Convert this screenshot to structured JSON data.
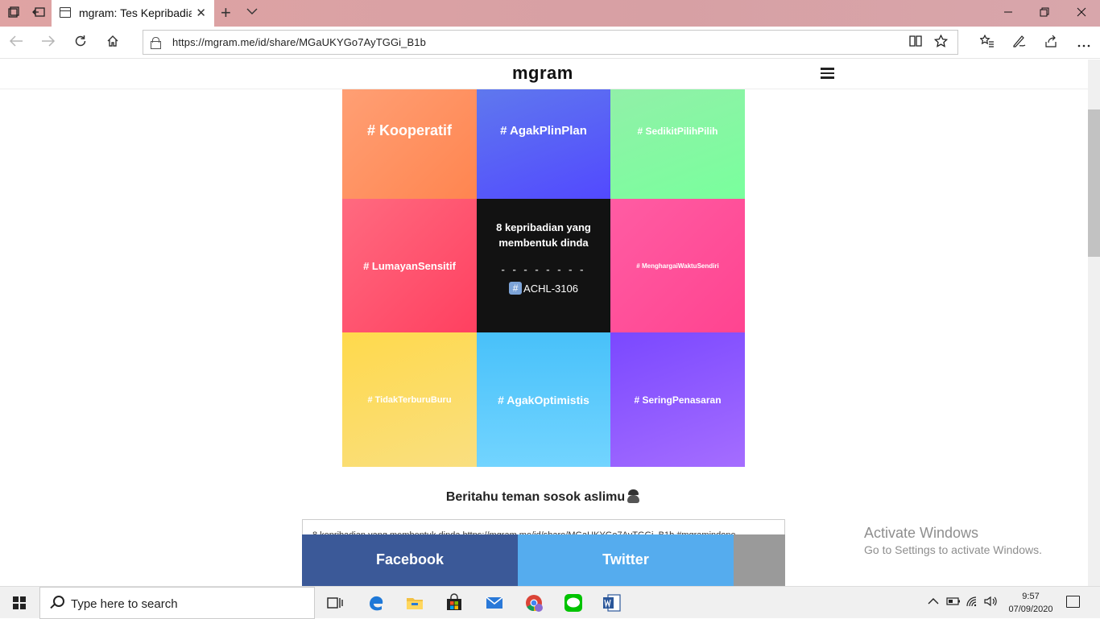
{
  "browser": {
    "tab_title": "mgram: Tes Kepribadiar",
    "tab_close": "✕",
    "new_tab": "+",
    "tab_menu": "⌵",
    "url": "https://mgram.me/id/share/MGaUKYGo7AyTGGi_B1b",
    "window_controls": {
      "minimize": "—",
      "restore": "❐",
      "close": "✕"
    }
  },
  "site": {
    "logo": "mgram"
  },
  "grid": {
    "cells": [
      {
        "tag": "# Kooperatif",
        "gradient": [
          "#ff9e6e",
          "#ff7e4e"
        ]
      },
      {
        "tag": "# AgakPlinPlan",
        "gradient": [
          "#5d7df0",
          "#5047ff"
        ]
      },
      {
        "tag": "# SedikitPilihPilih",
        "gradient": [
          "#8cf0a6",
          "#77ff9a"
        ]
      },
      {
        "tag": "# LumayanSensitif",
        "gradient": [
          "#ff6b7f",
          "#ff3f62"
        ]
      },
      {
        "tag": "# MenghargaiWaktuSendiri",
        "gradient": [
          "#ff5fa5",
          "#ff3f8a"
        ]
      },
      {
        "tag": "# TidakTerburuBuru",
        "gradient": [
          "#ffd84f",
          "#fbe07a"
        ]
      },
      {
        "tag": "# AgakOptimistis",
        "gradient": [
          "#4bc3fb",
          "#6fd3ff"
        ]
      },
      {
        "tag": "# SeringPenasaran",
        "gradient": [
          "#7b4bff",
          "#a46bff"
        ]
      }
    ],
    "center": {
      "title": "8 kepribadian yang membentuk dinda",
      "divider": "- - - - - - - -",
      "hash_symbol": "#",
      "code": "ACHL-3106"
    }
  },
  "share": {
    "title": "Beritahu teman sosok aslimu",
    "text": "8 kepribadian yang membentuk dinda https://mgram.me/id/share/MGaUKYGo7AyTGGi_B1b #mgramindone",
    "facebook_label": "Facebook",
    "twitter_label": "Twitter"
  },
  "watermark": {
    "line1": "Activate Windows",
    "line2": "Go to Settings to activate Windows."
  },
  "taskbar": {
    "search_placeholder": "Type here to search",
    "time": "9:57",
    "date": "07/09/2020"
  }
}
